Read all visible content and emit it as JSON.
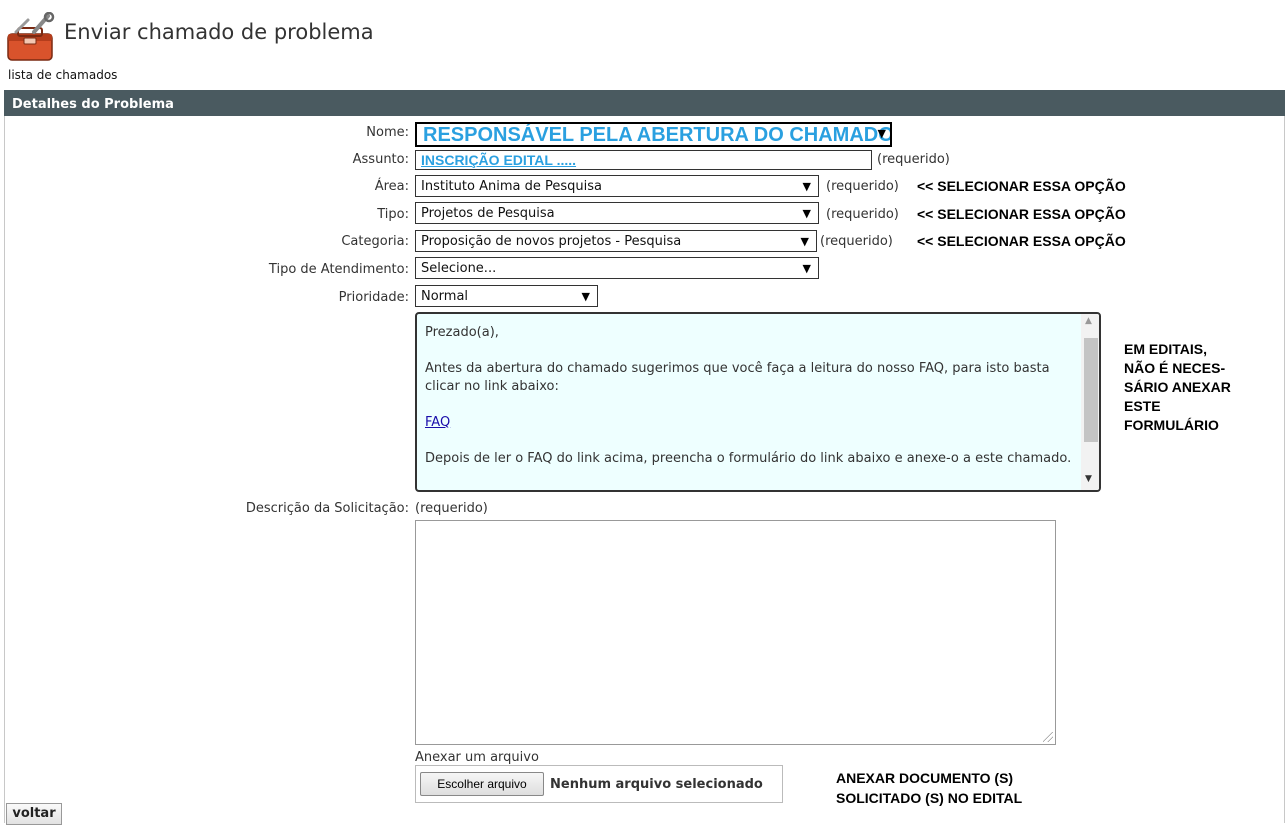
{
  "header": {
    "title": "Enviar chamado de problema",
    "list_link": "lista de chamados",
    "section_title": "Detalhes do Problema"
  },
  "form": {
    "nome": {
      "label": "Nome:",
      "value": "RESPONSÁVEL PELA ABERTURA DO CHAMADO"
    },
    "assunto": {
      "label": "Assunto:",
      "value": "INSCRIÇÃO EDITAL .....",
      "required": "(requerido)"
    },
    "area": {
      "label": "Área:",
      "value": "Instituto Anima de Pesquisa",
      "required": "(requerido)",
      "note": "<< SELECIONAR ESSA OPÇÃO"
    },
    "tipo": {
      "label": "Tipo:",
      "value": "Projetos de Pesquisa",
      "required": "(requerido)",
      "note": "<< SELECIONAR ESSA OPÇÃO"
    },
    "categoria": {
      "label": "Categoria:",
      "value": "Proposição de novos projetos - Pesquisa",
      "required": "(requerido)",
      "note": "<< SELECIONAR ESSA OPÇÃO"
    },
    "tipo_atendimento": {
      "label": "Tipo de Atendimento:",
      "value": "Selecione..."
    },
    "prioridade": {
      "label": "Prioridade:",
      "value": "Normal"
    },
    "dropdown_arrow": "▼"
  },
  "info_box": {
    "greeting": "Prezado(a),",
    "paragraph1": "Antes da abertura do chamado sugerimos que você faça a leitura do nosso FAQ, para isto basta clicar no link abaixo:",
    "faq_link": "FAQ",
    "paragraph2": "Depois de ler o FAQ do link acima, preencha o formulário do link abaixo e anexe-o a este chamado."
  },
  "side_note": {
    "line1": "EM EDITAIS,",
    "line2": "NÃO É NECES-",
    "line3": "SÁRIO ANEXAR",
    "line4": "ESTE",
    "line5": "FORMULÁRIO"
  },
  "descricao": {
    "label": "Descrição da Solicitação:",
    "required": "(requerido)"
  },
  "attachment": {
    "label": "Anexar um arquivo",
    "choose_button": "Escolher arquivo",
    "status": "Nenhum arquivo selecionado",
    "note_line1": "ANEXAR DOCUMENTO (S)",
    "note_line2": "SOLICITADO (S) NO EDITAL"
  },
  "footer": {
    "back_button": "voltar"
  },
  "colors": {
    "section_bar": "#4a5a60",
    "highlight_text": "#2aa0e0",
    "info_bg": "#eeffff",
    "app_icon": "#d9532c"
  },
  "icons": {
    "app_icon": "toolbox-wrench-icon",
    "scroll_up": "scroll-up-arrow-icon",
    "scroll_down": "scroll-down-arrow-icon"
  }
}
